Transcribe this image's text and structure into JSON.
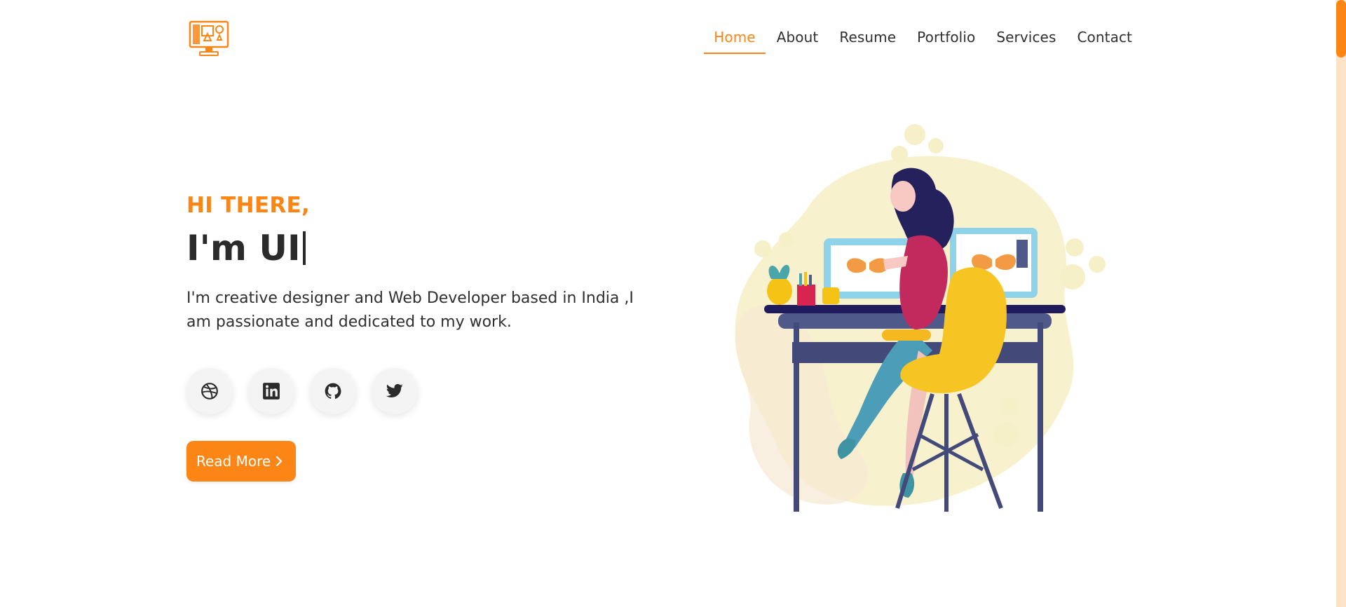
{
  "brand": {
    "logo_icon": "design-monitor-icon",
    "accent_color": "#fb8616"
  },
  "nav": {
    "items": [
      {
        "label": "Home",
        "active": true
      },
      {
        "label": "About",
        "active": false
      },
      {
        "label": "Resume",
        "active": false
      },
      {
        "label": "Portfolio",
        "active": false
      },
      {
        "label": "Services",
        "active": false
      },
      {
        "label": "Contact",
        "active": false
      }
    ]
  },
  "hero": {
    "greeting": "HI THERE,",
    "headline": "I'm UI",
    "intro": "I'm creative designer and Web Developer based in India ,I am passionate and dedicated to my work.",
    "socials": [
      {
        "icon": "dribbble-icon"
      },
      {
        "icon": "linkedin-icon"
      },
      {
        "icon": "github-icon"
      },
      {
        "icon": "twitter-icon"
      }
    ],
    "read_more_label": "Read More",
    "read_more_icon": "chevron-right-icon"
  },
  "illustration": {
    "subject": "woman-designer-at-desk-illustration"
  }
}
